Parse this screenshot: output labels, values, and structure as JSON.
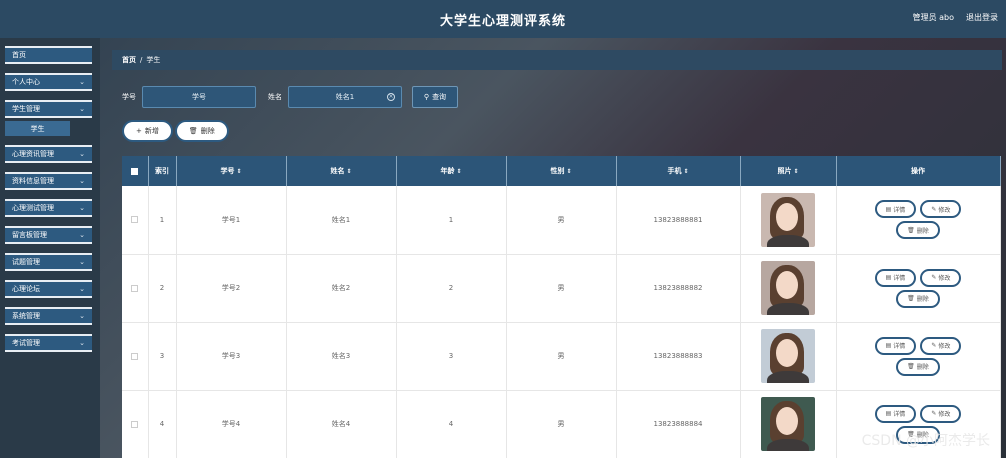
{
  "header": {
    "title": "大学生心理测评系统",
    "user_label": "管理员 abo",
    "logout_label": "退出登录"
  },
  "sidebar": {
    "items": [
      {
        "label": "首页",
        "chevron": ""
      },
      {
        "label": "个人中心",
        "chevron": "⌄"
      },
      {
        "label": "学生管理",
        "chevron": "⌄"
      },
      {
        "label": "心理资讯管理",
        "chevron": "⌄"
      },
      {
        "label": "资料信息管理",
        "chevron": "⌄"
      },
      {
        "label": "心理测试管理",
        "chevron": "⌄"
      },
      {
        "label": "留言板管理",
        "chevron": "⌄"
      },
      {
        "label": "试题管理",
        "chevron": "⌄"
      },
      {
        "label": "心理论坛",
        "chevron": "⌄"
      },
      {
        "label": "系统管理",
        "chevron": "⌄"
      },
      {
        "label": "考试管理",
        "chevron": "⌄"
      }
    ],
    "sub_item": "学生"
  },
  "breadcrumb": {
    "home": "首页",
    "sep": "/",
    "current": "学生"
  },
  "search": {
    "student_label": "学号",
    "student_placeholder": "学号",
    "name_label": "姓名",
    "name_value": "姓名1",
    "query_label": "查询"
  },
  "actions": {
    "add_label": "新增",
    "delete_label": "删除"
  },
  "table": {
    "headers": {
      "index": "索引",
      "student_no": "学号",
      "name": "姓名",
      "age": "年龄",
      "gender": "性别",
      "phone": "手机",
      "photo": "照片",
      "ops": "操作"
    },
    "sort_icon": "⇕",
    "rows": [
      {
        "index": "1",
        "student_no": "学号1",
        "name": "姓名1",
        "age": "1",
        "gender": "男",
        "phone": "13823888881"
      },
      {
        "index": "2",
        "student_no": "学号2",
        "name": "姓名2",
        "age": "2",
        "gender": "男",
        "phone": "13823888882"
      },
      {
        "index": "3",
        "student_no": "学号3",
        "name": "姓名3",
        "age": "3",
        "gender": "男",
        "phone": "13823888883"
      },
      {
        "index": "4",
        "student_no": "学号4",
        "name": "姓名4",
        "age": "4",
        "gender": "男",
        "phone": "13823888884"
      }
    ],
    "op_detail": "详情",
    "op_edit": "修改",
    "op_delete": "删除"
  },
  "watermark": "CSDN @小阿杰学长"
}
